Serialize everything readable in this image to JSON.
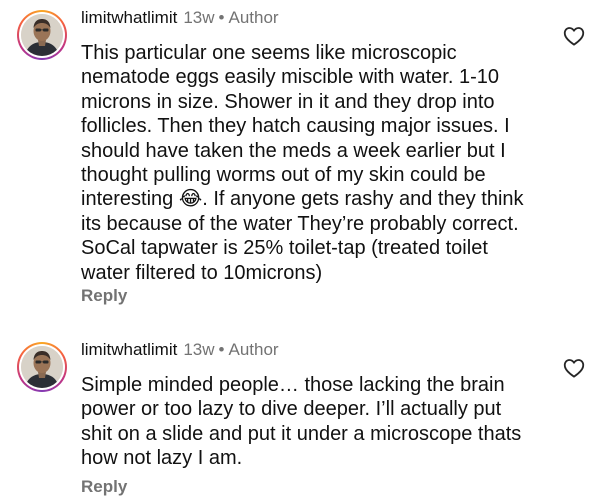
{
  "comments": [
    {
      "username": "limitwhatlimit",
      "time": "13w",
      "separator": "•",
      "badge": "Author",
      "text": "This particular one seems like microscopic\nnematode eggs easily miscible with water. 1-10\nmicrons in size. Shower in it and they drop into\nfollicles. Then they hatch causing major issues. I\nshould have taken the meds a week earlier but I\nthought pulling worms out of my skin could be\ninteresting 😂. If anyone gets rashy and they think\nits because of the water They’re probably correct.\nSoCal tapwater is 25% toilet-tap (treated toilet\nwater filtered to 10microns)",
      "reply_label": "Reply",
      "like_icon": "heart-outline-icon"
    },
    {
      "username": "limitwhatlimit",
      "time": "13w",
      "separator": "•",
      "badge": "Author",
      "text": "Simple minded people… those lacking the brain\npower or too lazy to dive deeper. I’ll actually put\nshit on a slide and put it under a microscope thats\nhow not lazy I am.",
      "reply_label": "Reply",
      "like_icon": "heart-outline-icon"
    }
  ],
  "colors": {
    "text": "#111111",
    "secondary": "#737373",
    "ring": [
      "#f9a825",
      "#f56040",
      "#c13584",
      "#833ab4"
    ]
  }
}
